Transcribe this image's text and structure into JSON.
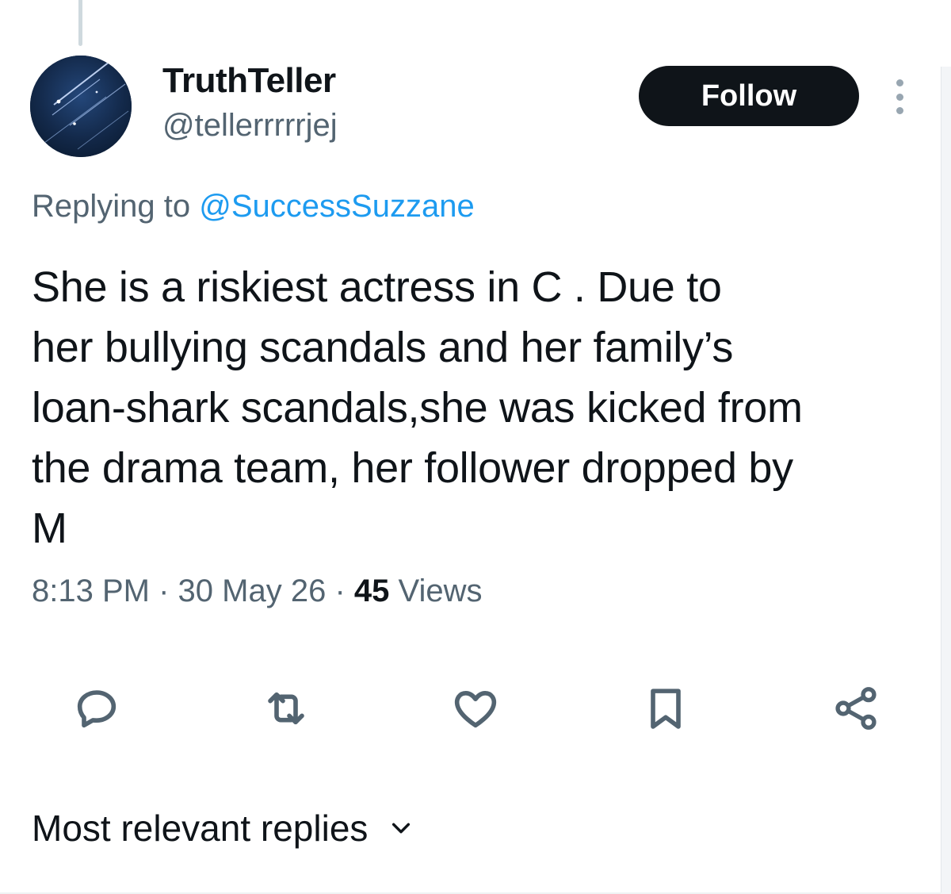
{
  "author": {
    "name": "TruthTeller",
    "handle": "@tellerrrrrjej",
    "avatar_icon": "avatar-meteor-image"
  },
  "follow_button": {
    "label": "Follow"
  },
  "more_menu": {
    "icon": "more-vertical-icon"
  },
  "reply_context": {
    "prefix": "Replying to",
    "mention": "@SuccessSuzzane"
  },
  "tweet": {
    "text": "She is a riskiest actress in C . Due to\nher bullying scandals and her family’s\nloan-shark scandals,she was kicked from\nthe drama team, her follower dropped by\nM"
  },
  "meta": {
    "time": "8:13 PM",
    "separator": "·",
    "date": "30 May 26",
    "views_count": "45",
    "views_label": "Views"
  },
  "actions": [
    {
      "name": "reply",
      "icon": "reply-icon"
    },
    {
      "name": "retweet",
      "icon": "retweet-icon"
    },
    {
      "name": "like",
      "icon": "heart-icon"
    },
    {
      "name": "bookmark",
      "icon": "bookmark-icon"
    },
    {
      "name": "share",
      "icon": "share-icon"
    }
  ],
  "replies_sort": {
    "label": "Most relevant replies",
    "icon": "chevron-down-icon"
  },
  "colors": {
    "text_primary": "#0f1419",
    "text_secondary": "#536471",
    "link": "#1d9bf0",
    "icon": "#536471"
  }
}
